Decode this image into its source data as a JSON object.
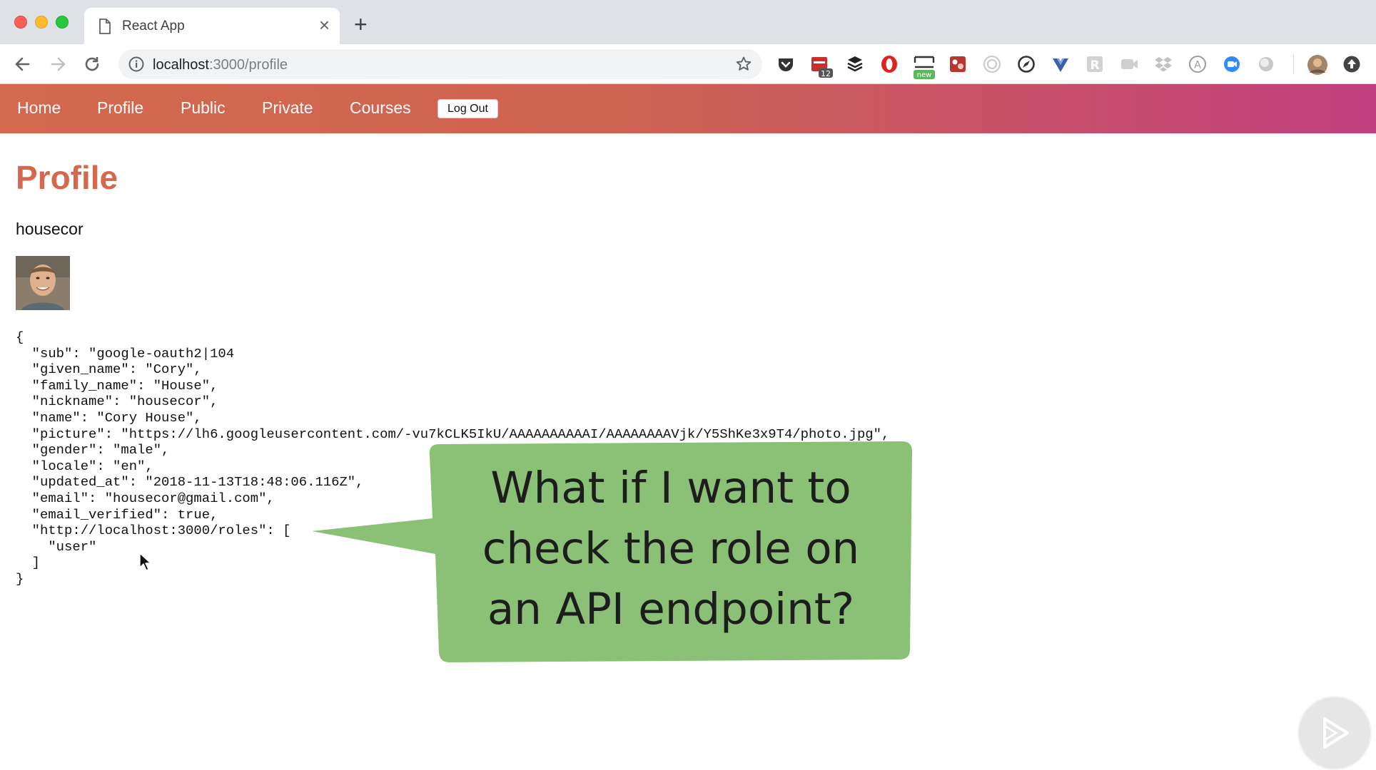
{
  "browser": {
    "tab": {
      "title": "React App",
      "close_glyph": "×",
      "page_icon": "page-icon"
    },
    "new_tab_glyph": "+",
    "url": {
      "host": "localhost",
      "path": ":3000/profile"
    },
    "extensions": [
      "pocket-icon",
      "calendar-icon",
      "buffer-icon",
      "opera-icon",
      "screenshot-icon",
      "photo-icon",
      "target-icon",
      "compass-icon",
      "vue-icon",
      "r-icon",
      "video-icon",
      "dropbox-icon",
      "accessibility-icon",
      "zoom-icon",
      "toggle-icon",
      "profile-avatar",
      "update-icon"
    ],
    "extension_badges": {
      "calendar": "12",
      "screenshot": "new"
    }
  },
  "app_nav": {
    "links": [
      "Home",
      "Profile",
      "Public",
      "Private",
      "Courses"
    ],
    "logout_label": "Log Out"
  },
  "page": {
    "title": "Profile",
    "nickname": "housecor"
  },
  "profile_json": [
    "{",
    "  \"sub\": \"google-oauth2|104",
    "  \"given_name\": \"Cory\",",
    "  \"family_name\": \"House\",",
    "  \"nickname\": \"housecor\",",
    "  \"name\": \"Cory House\",",
    "  \"picture\": \"https://lh6.googleusercontent.com/-vu7kCLK5IkU/AAAAAAAAAAI/AAAAAAAAVjk/Y5ShKe3x9T4/photo.jpg\",",
    "  \"gender\": \"male\",",
    "  \"locale\": \"en\",",
    "  \"updated_at\": \"2018-11-13T18:48:06.116Z\",",
    "  \"email\": \"housecor@gmail.com\",",
    "  \"email_verified\": true,",
    "  \"http://localhost:3000/roles\": [",
    "    \"user\"",
    "  ]",
    "}"
  ],
  "callout": {
    "lines": [
      "What if I want to",
      "check the role on",
      "an API endpoint?"
    ],
    "color": "#8bc177"
  },
  "colors": {
    "nav_gradient_start": "#d4694e",
    "nav_gradient_end": "#c13f7e",
    "title": "#d4694e"
  }
}
